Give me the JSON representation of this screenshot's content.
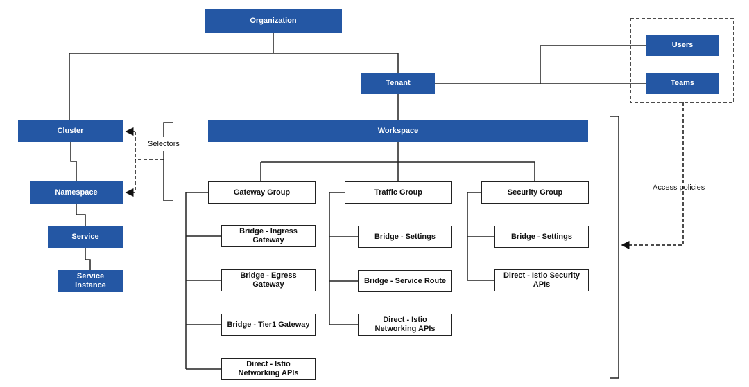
{
  "nodes": {
    "organization": "Organization",
    "tenant": "Tenant",
    "users": "Users",
    "teams": "Teams",
    "workspace": "Workspace",
    "cluster": "Cluster",
    "namespace": "Namespace",
    "service": "Service",
    "service_instance": "Service Instance",
    "gateway_group": "Gateway Group",
    "traffic_group": "Traffic Group",
    "security_group": "Security Group",
    "gw_ingress": "Bridge - Ingress Gateway",
    "gw_egress": "Bridge - Egress Gateway",
    "gw_tier1": "Bridge - Tier1 Gateway",
    "gw_direct": "Direct - Istio Networking APIs",
    "tr_settings": "Bridge - Settings",
    "tr_route": "Bridge - Service Route",
    "tr_direct": "Direct - Istio Networking APIs",
    "sec_settings": "Bridge - Settings",
    "sec_direct": "Direct - Istio Security APIs"
  },
  "labels": {
    "selectors": "Selectors",
    "access_policies": "Access policies"
  },
  "colors": {
    "primary_box": "#2457a4",
    "line": "#222222"
  }
}
